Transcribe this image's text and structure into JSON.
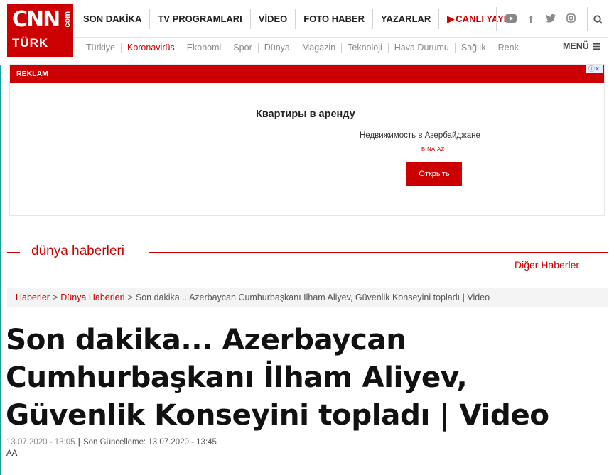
{
  "logo": {
    "cnn": "CNN",
    "turk": "TÜRK",
    "dotcom": "com"
  },
  "topnav": {
    "items": [
      "SON DAKİKA",
      "TV PROGRAMLARI",
      "VİDEO",
      "FOTO HABER",
      "YAZARLAR"
    ],
    "live": "CANLI YAYIN"
  },
  "social": [
    "youtube-icon",
    "facebook-icon",
    "twitter-icon",
    "instagram-icon"
  ],
  "subnav": {
    "items": [
      "Türkiye",
      "Koronavirüs",
      "Ekonomi",
      "Spor",
      "Dünya",
      "Magazin",
      "Teknoloji",
      "Hava Durumu",
      "Sağlık",
      "Renk"
    ],
    "active": "Koronavirüs",
    "menu": "MENÜ"
  },
  "ad": {
    "label": "REKLAM",
    "title": "Квартиры в аренду",
    "subtitle": "Недвижимость в Азербайджане",
    "domain": "BINA.AZ",
    "button": "Открыть"
  },
  "section": {
    "title": "dünya haberleri",
    "other": "Diğer Haberler"
  },
  "breadcrumb": {
    "items": [
      "Haberler",
      "Dünya Haberleri"
    ],
    "current": "Son dakika... Azerbaycan Cumhurbaşkanı İlham Aliyev, Güvenlik Konseyini topladı | Video",
    "separator": ">"
  },
  "article": {
    "headline": "Son dakika... Azerbaycan Cumhurbaşkanı İlham Aliyev, Güvenlik Konseyini topladı | Video",
    "published": "13.07.2020 - 13:05",
    "updated": "Son Güncelleme: 13.07.2020 - 13:45",
    "source": "AA"
  },
  "colors": {
    "brand": "#cc0000",
    "text": "#111111",
    "muted": "#888888"
  }
}
